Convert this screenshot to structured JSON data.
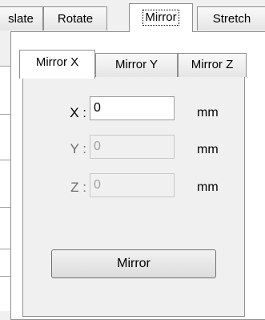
{
  "outer_tabs": [
    "slate",
    "Rotate",
    "Mirror",
    "Stretch"
  ],
  "inner_tabs": [
    "Mirror X",
    "Mirror Y",
    "Mirror Z"
  ],
  "fields": {
    "x": {
      "label": "X :",
      "value": "0",
      "unit": "mm",
      "enabled": true
    },
    "y": {
      "label": "Y :",
      "value": "0",
      "unit": "mm",
      "enabled": false
    },
    "z": {
      "label": "Z :",
      "value": "0",
      "unit": "mm",
      "enabled": false
    }
  },
  "mirror_button_label": "Mirror"
}
